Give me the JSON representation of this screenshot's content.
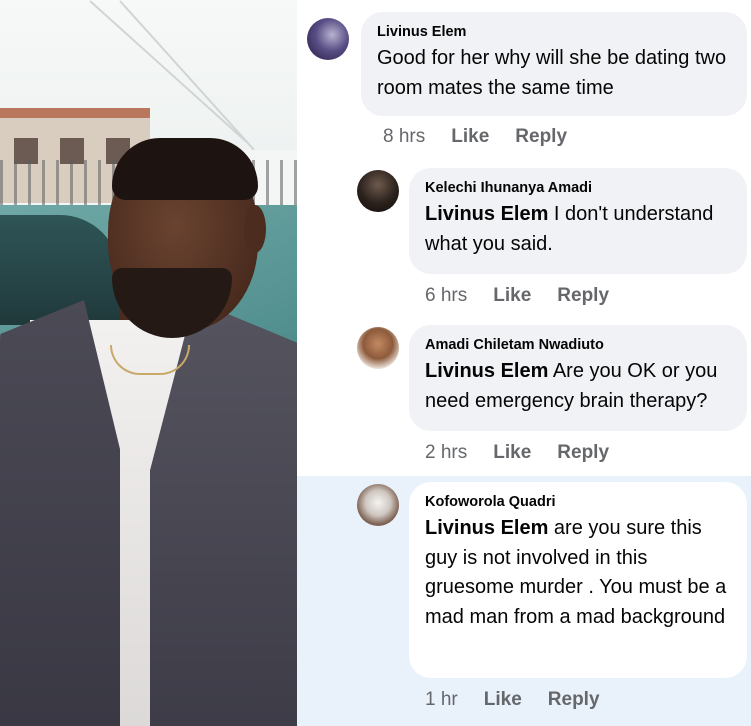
{
  "comments": [
    {
      "author": "Livinus Elem",
      "mention": "",
      "text": "Good for her why will she be dating two room mates the same time",
      "time": "8 hrs",
      "like": "Like",
      "reply": "Reply"
    },
    {
      "author": "Kelechi Ihunanya Amadi",
      "mention": "Livinus Elem",
      "text": " I don't understand what you said.",
      "time": "6 hrs",
      "like": "Like",
      "reply": "Reply"
    },
    {
      "author": "Amadi Chiletam Nwadiuto",
      "mention": "Livinus Elem",
      "text": " Are you OK or you need emergency brain therapy?",
      "time": "2 hrs",
      "like": "Like",
      "reply": "Reply"
    },
    {
      "author": "Kofoworola Quadri",
      "mention": "Livinus Elem",
      "text": " are you sure this guy is not involved in this gruesome murder . You must be a mad man from a mad background",
      "time": "1 hr",
      "like": "Like",
      "reply": "Reply"
    }
  ],
  "colors": {
    "bubble": "#f0f2f5",
    "highlight_background": "#e9f1fb",
    "meta_text": "#65676b"
  },
  "icons": [
    "profile-photo",
    "avatar-livinus",
    "avatar-kelechi",
    "avatar-amadi",
    "avatar-kofoworola"
  ]
}
